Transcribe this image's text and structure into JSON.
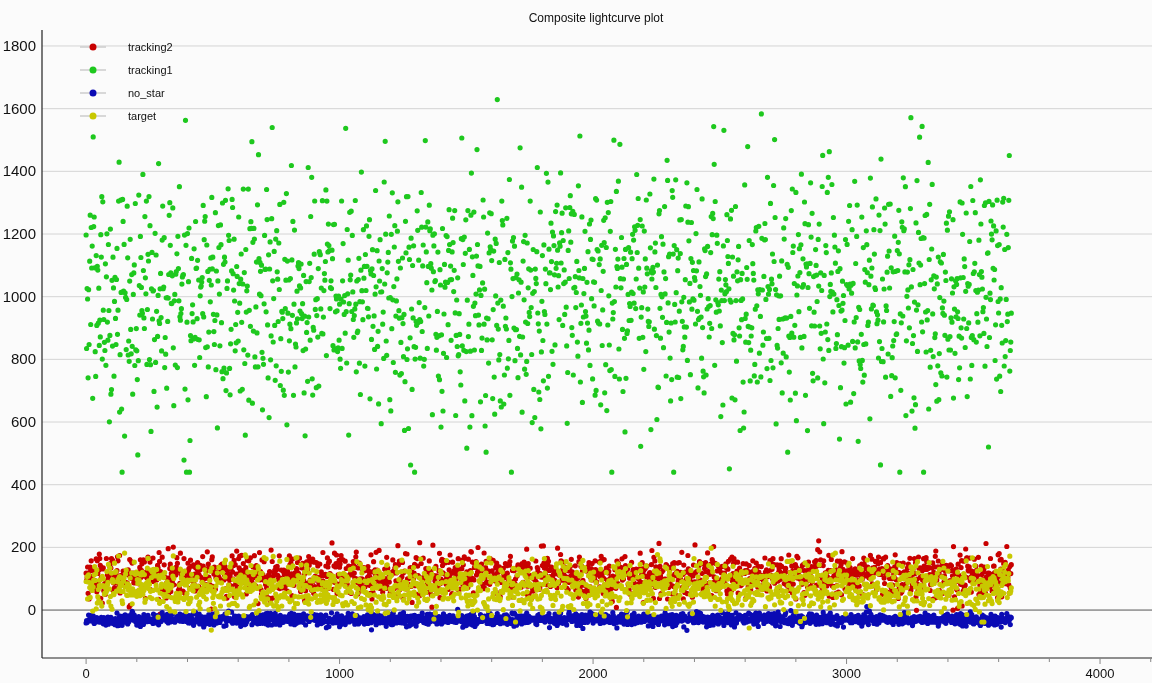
{
  "plot": {
    "title": "Composite lightcurve plot",
    "legend": [
      {
        "label": "tracking2",
        "color": "#c80000"
      },
      {
        "label": "tracking1",
        "color": "#1ec81e"
      },
      {
        "label": "no_star",
        "color": "#0a0ab4"
      },
      {
        "label": "target",
        "color": "#c8c800"
      }
    ],
    "y_axis_labels": [
      "1800",
      "1600",
      "1400",
      "1200",
      "1000",
      "800",
      "600",
      "400",
      "200",
      "0"
    ],
    "x_axis_labels": [
      "0",
      "1000",
      "2000",
      "3000",
      "4000"
    ]
  }
}
